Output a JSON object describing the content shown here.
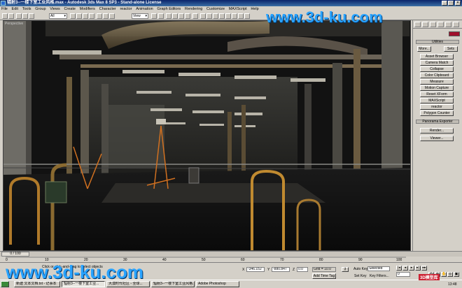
{
  "window": {
    "title": "辐射3--一楼下室工业风格.max - Autodesk 3ds Max 8 SP3 - Stand-alone License"
  },
  "menu": [
    "File",
    "Edit",
    "Tools",
    "Group",
    "Views",
    "Create",
    "Modifiers",
    "Character",
    "reactor",
    "Animation",
    "Graph Editors",
    "Rendering",
    "Customize",
    "MAXScript",
    "Help"
  ],
  "toolbar": {
    "filter_select": "All",
    "refcoord_select": "View"
  },
  "viewport": {
    "label": "Perspective"
  },
  "watermark": "www.3d-ku.com",
  "command_panel": {
    "utilities_title": "Utilities",
    "more_label": "More...",
    "sets_label": "Sets",
    "utility_buttons": [
      "Asset Browser",
      "Camera Match",
      "Collapse",
      "Color Clipboard",
      "Measure",
      "Motion Capture",
      "Reset XForm",
      "MAXScript",
      "reactor",
      "Polygon Counter"
    ],
    "panorama_title": "Panorama Exporter",
    "render_label": "Render...",
    "viewer_label": "Viewer...",
    "color_swatch": "#a1102c"
  },
  "time": {
    "slider_label": "0 / 100",
    "ticks": [
      "0",
      "10",
      "20",
      "30",
      "40",
      "50",
      "60",
      "70",
      "80",
      "90",
      "100"
    ]
  },
  "status": {
    "prompt": "Click or click-and-drag to select objects",
    "x_value": "-346.152",
    "y_value": "-880.847",
    "z_value": "0.0",
    "grid": "Grid = 10.0",
    "add_time_tag": "Add Time Tag",
    "auto_key": "Auto Key",
    "auto_key_select": "Selected",
    "set_key": "Set Key",
    "key_filters": "Key Filters...",
    "frame": "0"
  },
  "taskbar": {
    "items": [
      "新建 文本文档.txt - 记事本",
      "辐射3--一楼下室工业...",
      "大漠时代社区 - 全球...",
      "辐射3--一楼下室工业风格...",
      "Adobe Photoshop"
    ],
    "clock": "13:48"
  },
  "corner_logo": "3D模型库"
}
